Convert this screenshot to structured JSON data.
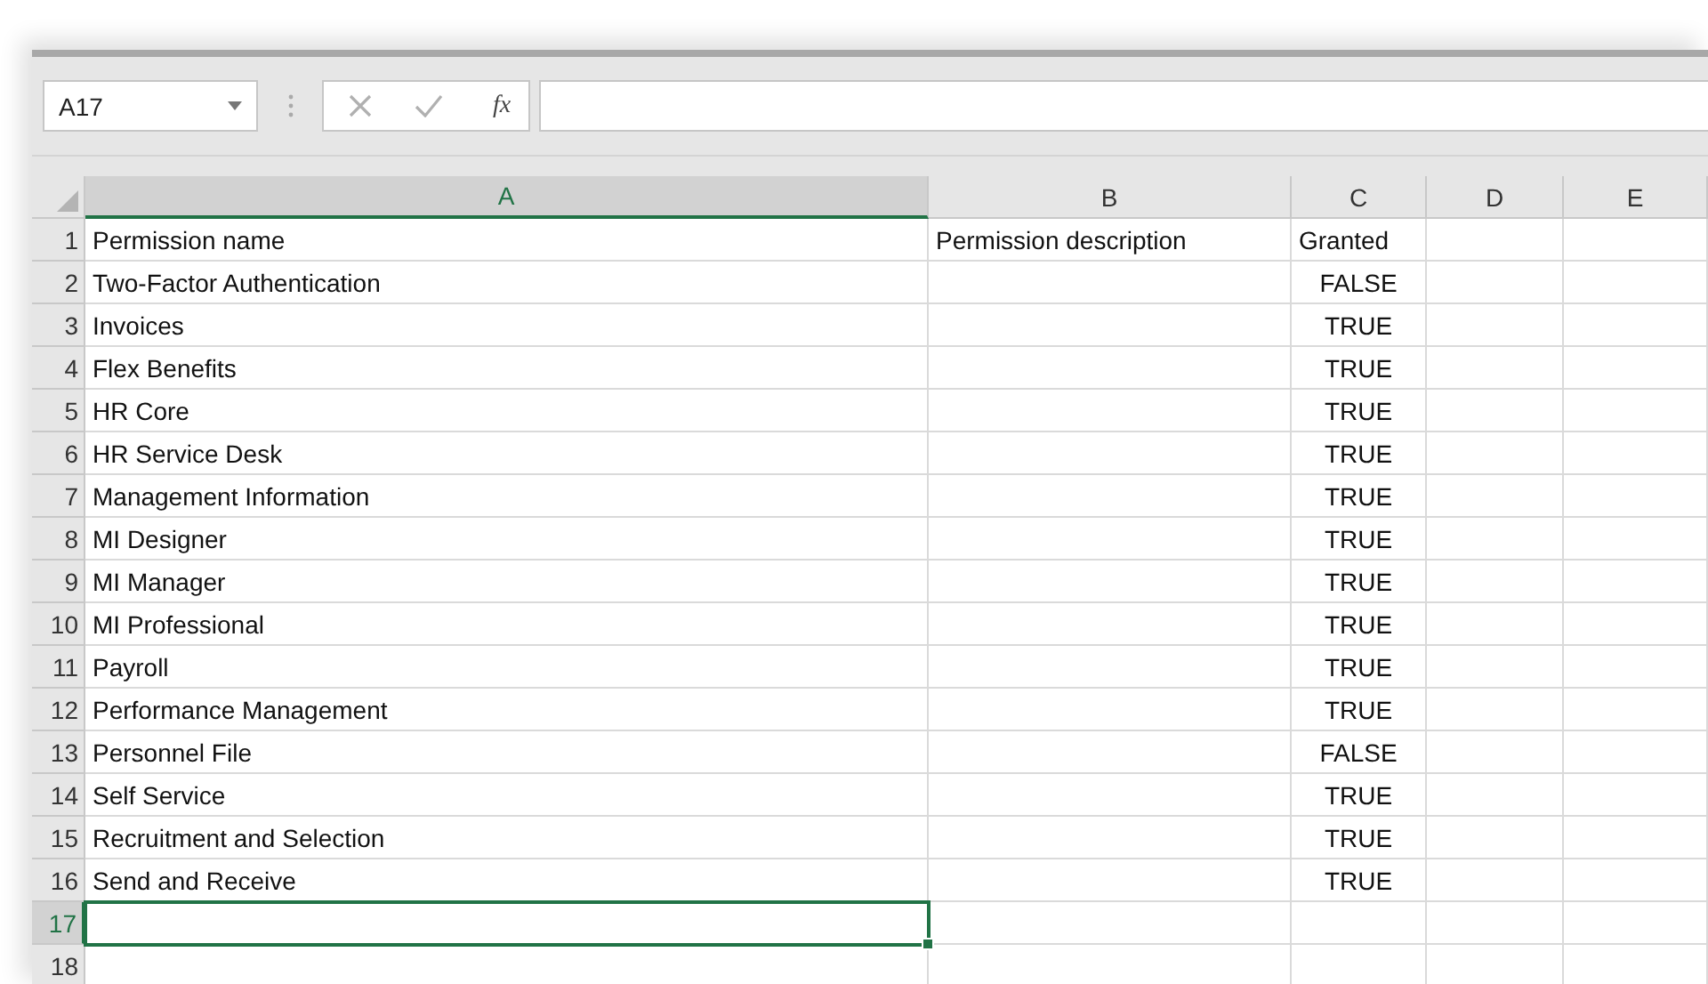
{
  "formula_bar": {
    "name_box": "A17",
    "cancel_disabled": true,
    "enter_disabled": true,
    "function_label": "fx"
  },
  "columns": [
    {
      "label": "A",
      "selected": true
    },
    {
      "label": "B",
      "selected": false
    },
    {
      "label": "C",
      "selected": false
    },
    {
      "label": "D",
      "selected": false
    },
    {
      "label": "E",
      "selected": false
    }
  ],
  "rows": [
    {
      "number": "1",
      "selected": false,
      "a": "Permission name",
      "b": "Permission description",
      "c": {
        "text": "Granted",
        "kind": "text"
      }
    },
    {
      "number": "2",
      "selected": false,
      "a": "Two-Factor Authentication",
      "c": {
        "text": "FALSE",
        "kind": "boolean"
      }
    },
    {
      "number": "3",
      "selected": false,
      "a": "Invoices",
      "c": {
        "text": "TRUE",
        "kind": "boolean"
      }
    },
    {
      "number": "4",
      "selected": false,
      "a": "Flex Benefits",
      "c": {
        "text": "TRUE",
        "kind": "boolean"
      }
    },
    {
      "number": "5",
      "selected": false,
      "a": "HR Core",
      "c": {
        "text": "TRUE",
        "kind": "boolean"
      }
    },
    {
      "number": "6",
      "selected": false,
      "a": "HR Service Desk",
      "c": {
        "text": "TRUE",
        "kind": "boolean"
      }
    },
    {
      "number": "7",
      "selected": false,
      "a": "Management Information",
      "c": {
        "text": "TRUE",
        "kind": "boolean"
      }
    },
    {
      "number": "8",
      "selected": false,
      "a": "MI Designer",
      "c": {
        "text": "TRUE",
        "kind": "boolean"
      }
    },
    {
      "number": "9",
      "selected": false,
      "a": "MI Manager",
      "c": {
        "text": "TRUE",
        "kind": "boolean"
      }
    },
    {
      "number": "10",
      "selected": false,
      "a": "MI Professional",
      "c": {
        "text": "TRUE",
        "kind": "boolean"
      }
    },
    {
      "number": "11",
      "selected": false,
      "a": "Payroll",
      "c": {
        "text": "TRUE",
        "kind": "boolean"
      }
    },
    {
      "number": "12",
      "selected": false,
      "a": "Performance Management",
      "c": {
        "text": "TRUE",
        "kind": "boolean"
      }
    },
    {
      "number": "13",
      "selected": false,
      "a": "Personnel File",
      "c": {
        "text": "FALSE",
        "kind": "boolean"
      }
    },
    {
      "number": "14",
      "selected": false,
      "a": "Self Service",
      "c": {
        "text": "TRUE",
        "kind": "boolean"
      }
    },
    {
      "number": "15",
      "selected": false,
      "a": "Recruitment and Selection",
      "c": {
        "text": "TRUE",
        "kind": "boolean"
      }
    },
    {
      "number": "16",
      "selected": false,
      "a": "Send and Receive",
      "c": {
        "text": "TRUE",
        "kind": "boolean"
      }
    },
    {
      "number": "17",
      "selected": true
    },
    {
      "number": "18",
      "selected": false
    }
  ]
}
